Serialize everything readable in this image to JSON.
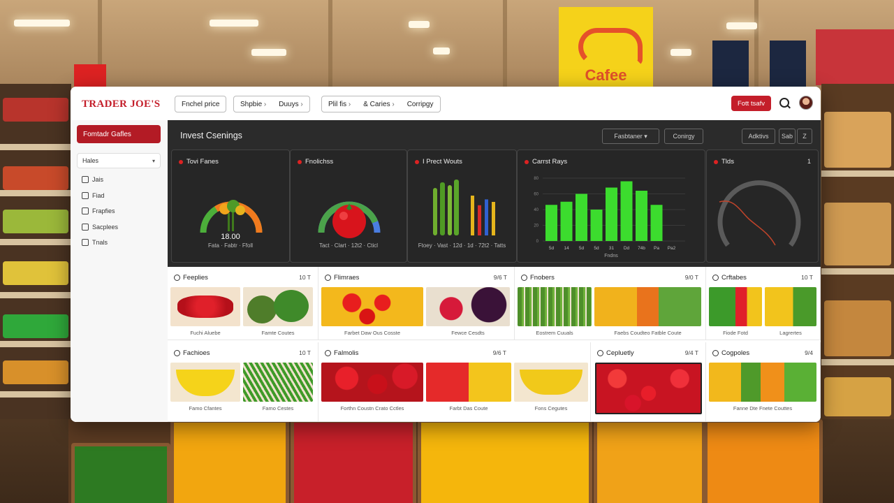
{
  "background": {
    "cafe_sign": "Cafee"
  },
  "header": {
    "logo": "TRADER JOE'S",
    "nav_groups": [
      {
        "items": [
          {
            "label": "Fnchel price",
            "dropdown": false
          }
        ]
      },
      {
        "items": [
          {
            "label": "Shpbie",
            "dropdown": true
          },
          {
            "label": "Duuys",
            "dropdown": true
          }
        ]
      },
      {
        "items": [
          {
            "label": "Plil fis",
            "dropdown": true
          },
          {
            "label": "& Caries",
            "dropdown": true
          },
          {
            "label": "Corripgy",
            "dropdown": false
          }
        ]
      }
    ],
    "action_button": "Fott tsafv",
    "search_icon": "search-icon",
    "avatar": "user-avatar"
  },
  "sidebar": {
    "primary_button": "Fomtadr Gafles",
    "select_value": "Hales",
    "items": [
      {
        "label": "Jais",
        "icon": "doc-icon"
      },
      {
        "label": "Fiad",
        "icon": "doc-icon"
      },
      {
        "label": "Frapfies",
        "icon": "list-icon"
      },
      {
        "label": "Sacplees",
        "icon": "list-icon"
      },
      {
        "label": "Tnals",
        "icon": "list-icon"
      }
    ]
  },
  "dashboard": {
    "title": "Invest Csenings",
    "controls": {
      "dropdown": "Fasbtaner",
      "button1": "Conirgy",
      "button2": "Adktivs",
      "button3": "Sab",
      "button4": "Z"
    },
    "cards": [
      {
        "title": "Tovi Fanes",
        "value": "18.00",
        "caption": "Fata · Fabtr · Ffoll",
        "gauge_fraction": 0.72,
        "gauge_color": "#f07a1e",
        "gauge_color2": "#4caf3a"
      },
      {
        "title": "Fnolichss",
        "caption": "Tact · Clart · 12t2 · Cticl",
        "gauge_fraction": 0.64,
        "gauge_color": "#4ba34a",
        "gauge_color2": "#4a7de0"
      },
      {
        "title": "I Prect Wouts",
        "caption": "Ftoey · Vast · 12d · 1d · 72t2 · Tatts"
      },
      {
        "title": "Carrst Rays",
        "x_label": "Fndns"
      },
      {
        "title": "Tlds",
        "badge": "1"
      }
    ]
  },
  "chart_data": {
    "type": "bar",
    "title": "Carrst Rays",
    "categories": [
      "5d",
      "14",
      "5d",
      "5d",
      "31",
      "Dd",
      "74b",
      "Pa",
      "Pa2"
    ],
    "values": [
      46,
      50,
      60,
      40,
      68,
      76,
      64,
      46,
      0
    ],
    "ylim": [
      0,
      80
    ],
    "xlabel": "Fndns",
    "bar_color": "#3cdc2e"
  },
  "mini_bars": {
    "colors": [
      "#e5b51c",
      "#d62a2a",
      "#3060d0",
      "#e5b51c"
    ],
    "values": [
      0.95,
      0.72,
      0.86,
      0.8
    ]
  },
  "sections": [
    {
      "title": "Feeplies",
      "count": "10 T",
      "captions": [
        "Fuchi Aluebe",
        "Famte Coutes"
      ]
    },
    {
      "title": "Flimraes",
      "count": "9/6 T",
      "captions": [
        "Farbet Daw Ous Cosste",
        "Fewce Cesdts"
      ]
    },
    {
      "title": "Fnobers",
      "count": "9/0 T",
      "captions": [
        "Eostrem Cuuals",
        "Faebs Coudteo  Fatble  Coute"
      ]
    },
    {
      "title": "Crftabes",
      "count": "10 T",
      "captions": [
        "Fiode Fotd",
        "Lagrertes"
      ]
    },
    {
      "title": "Fachioes",
      "count": "10 T",
      "captions": [
        "Famo Cfantes",
        "Famo Cestes"
      ]
    },
    {
      "title": "Falmolis",
      "count": "9/6 T",
      "captions": [
        "Forthn Coustn Crato Cctles",
        "Farbt Das Coute",
        "Fons Cegutes"
      ]
    },
    {
      "title": "Cepluetly",
      "count": "9/4 T",
      "captions": []
    },
    {
      "title": "Cogpoles",
      "count": "9/4",
      "captions": [
        "Fanne Dte Fnete Couttes"
      ]
    }
  ]
}
